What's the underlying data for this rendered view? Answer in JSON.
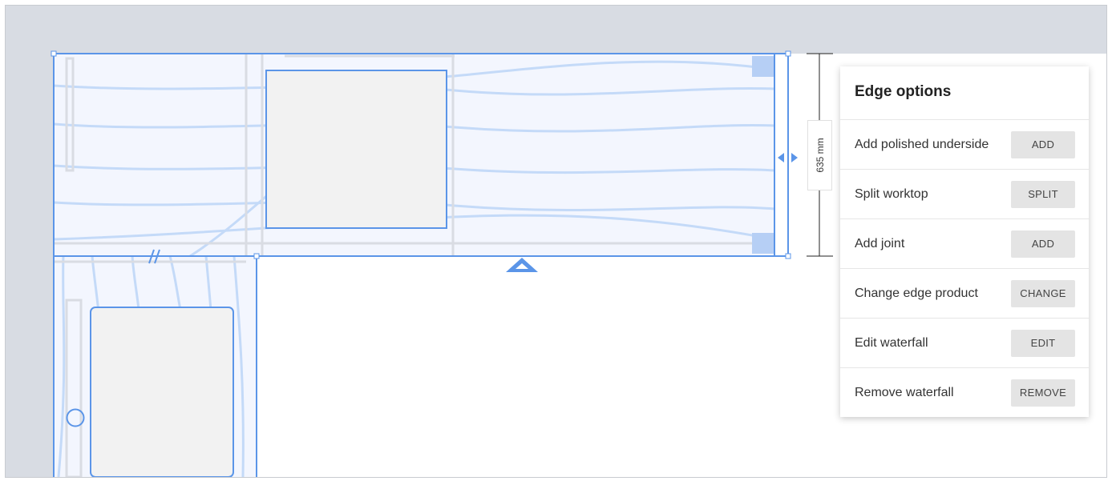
{
  "colors": {
    "accent": "#5b95e8",
    "selection_fill": "#f3f6fe",
    "grain": "#c4daf8",
    "sink": "#f2f2f2",
    "band": "#d8dce3"
  },
  "dimension": {
    "label": "635 mm"
  },
  "panel": {
    "title": "Edge options",
    "options": [
      {
        "label": "Add polished underside",
        "button": "ADD"
      },
      {
        "label": "Split worktop",
        "button": "SPLIT"
      },
      {
        "label": "Add joint",
        "button": "ADD"
      },
      {
        "label": "Change edge product",
        "button": "CHANGE"
      },
      {
        "label": "Edit waterfall",
        "button": "EDIT"
      },
      {
        "label": "Remove waterfall",
        "button": "REMOVE"
      }
    ]
  },
  "icons": {
    "resize": "double-arrow-horizontal-icon",
    "expand": "triangle-up-icon",
    "joint": "joint-marker-icon"
  }
}
